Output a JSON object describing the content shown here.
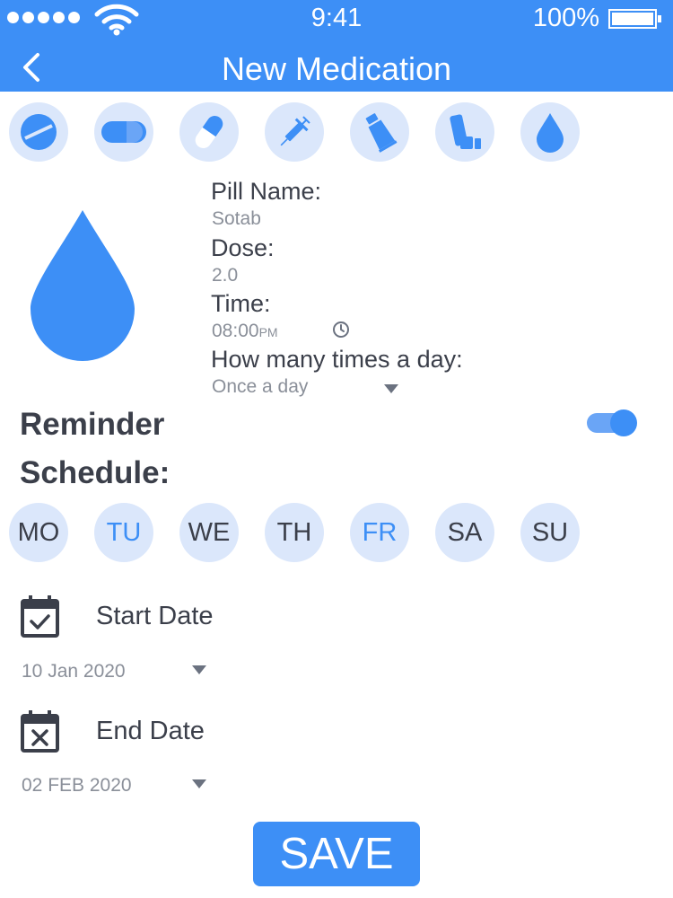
{
  "status_bar": {
    "time": "9:41",
    "battery": "100%"
  },
  "header": {
    "title": "New Medication"
  },
  "medication_types": [
    "tablet-icon",
    "capsule-icon",
    "pill-icon",
    "syringe-icon",
    "ointment-icon",
    "inhaler-icon",
    "drops-icon"
  ],
  "form": {
    "pill_name_label": "Pill Name:",
    "pill_name_value": "Sotab",
    "dose_label": "Dose:",
    "dose_value": "2.0",
    "time_label": "Time:",
    "time_value": "08:00",
    "time_suffix": "PM",
    "frequency_label": "How many times a day:",
    "frequency_value": "Once a day"
  },
  "reminder": {
    "label": "Reminder",
    "enabled": true
  },
  "schedule": {
    "label": "Schedule:",
    "days": [
      {
        "label": "MO",
        "active": false
      },
      {
        "label": "TU",
        "active": true
      },
      {
        "label": "WE",
        "active": false
      },
      {
        "label": "TH",
        "active": false
      },
      {
        "label": "FR",
        "active": true
      },
      {
        "label": "SA",
        "active": false
      },
      {
        "label": "SU",
        "active": false
      }
    ]
  },
  "start_date": {
    "label": "Start Date",
    "value": "10 Jan 2020"
  },
  "end_date": {
    "label": "End Date",
    "value": "02 FEB 2020"
  },
  "save_label": "SAVE",
  "colors": {
    "primary": "#3d8ff6",
    "circle_bg": "#dbe7fb",
    "text": "#3b3f4a",
    "muted": "#8a8f99"
  }
}
